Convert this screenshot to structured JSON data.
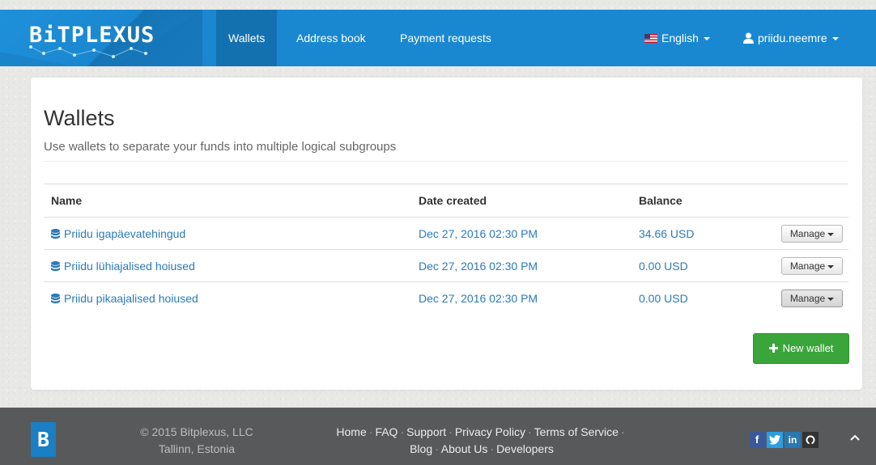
{
  "navbar": {
    "brand": "BiTPLEXUS",
    "items": [
      {
        "label": "Wallets",
        "active": true
      },
      {
        "label": "Address book",
        "active": false
      },
      {
        "label": "Payment requests",
        "active": false
      }
    ],
    "language": "English",
    "user": "priidu.neemre",
    "icons": [
      "us-flag-icon",
      "user-icon",
      "chevron-down-icon"
    ]
  },
  "page": {
    "title": "Wallets",
    "subtitle": "Use wallets to separate your funds into multiple logical subgroups"
  },
  "table": {
    "headers": [
      "Name",
      "Date created",
      "Balance"
    ],
    "rows": [
      {
        "name": "Priidu igapäevatehingud",
        "date": "Dec 27, 2016 02:30 PM",
        "balance": "34.66 USD",
        "action": "Manage"
      },
      {
        "name": "Priidu lühiajalised hoiused",
        "date": "Dec 27, 2016 02:30 PM",
        "balance": "0.00 USD",
        "action": "Manage"
      },
      {
        "name": "Priidu pikaajalised hoiused",
        "date": "Dec 27, 2016 02:30 PM",
        "balance": "0.00 USD",
        "action": "Manage"
      }
    ]
  },
  "new_wallet_label": "New wallet",
  "footer": {
    "logo": "B",
    "copyright_line1": "© 2015 Bitplexus, LLC",
    "copyright_line2": "Tallinn, Estonia",
    "links_row1": [
      "Home",
      "FAQ",
      "Support",
      "Privacy Policy",
      "Terms of Service"
    ],
    "links_row2": [
      "Blog",
      "About Us",
      "Developers"
    ],
    "social": [
      {
        "name": "facebook-icon",
        "glyph": "f",
        "color": "#3b5998"
      },
      {
        "name": "twitter-icon",
        "glyph": "t",
        "color": "#2b9fe0"
      },
      {
        "name": "linkedin-icon",
        "glyph": "in",
        "color": "#2a78b2"
      },
      {
        "name": "github-icon",
        "glyph": "o",
        "color": "#333333"
      }
    ]
  },
  "colors": {
    "navbar": "#1a88d0",
    "nav_active": "#1471b0",
    "link": "#2a7ab8",
    "success": "#3aa53a",
    "footer": "#58595b"
  }
}
